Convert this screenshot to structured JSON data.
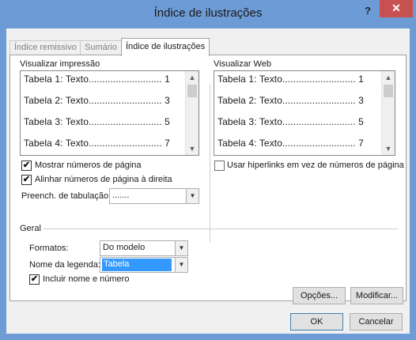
{
  "window": {
    "title": "Índice de ilustrações",
    "help_glyph": "?",
    "close_glyph": "✕"
  },
  "tabs": [
    {
      "label": "Índice remissivo",
      "active": false
    },
    {
      "label": "Sumário",
      "active": false
    },
    {
      "label": "Índice de ilustrações",
      "active": true
    }
  ],
  "print_preview": {
    "label": "Visualizar impressão",
    "rows": [
      "Tabela 1: Texto........................... 1",
      "Tabela 2: Texto........................... 3",
      "Tabela 3: Texto........................... 5",
      "Tabela 4: Texto........................... 7"
    ]
  },
  "web_preview": {
    "label": "Visualizar Web",
    "rows": [
      "Tabela 1: Texto........................... 1",
      "Tabela 2: Texto........................... 3",
      "Tabela 3: Texto........................... 5",
      "Tabela 4: Texto........................... 7"
    ]
  },
  "options": {
    "show_page_numbers": {
      "label": "Mostrar números de página",
      "checked": true
    },
    "right_align": {
      "label": "Alinhar números de página à direita",
      "checked": true
    },
    "tab_leader": {
      "label": "Preench. de tabulação:",
      "value": "......."
    },
    "use_hyperlinks": {
      "label": "Usar hiperlinks em vez de números de página",
      "checked": false
    }
  },
  "general": {
    "heading": "Geral",
    "formats": {
      "label": "Formatos:",
      "value": "Do modelo"
    },
    "caption_label": {
      "label": "Nome da legenda:",
      "value": "Tabela"
    },
    "include_label": {
      "label": "Incluir nome e número",
      "checked": true
    }
  },
  "buttons": {
    "options": "Opções...",
    "modify": "Modificar...",
    "ok": "OK",
    "cancel": "Cancelar"
  },
  "icons": {
    "check": "✔",
    "up": "▲",
    "down": "▼",
    "combo": "▼"
  },
  "colors": {
    "frame": "#6d9bd6",
    "close": "#c75050",
    "selection": "#3399ff"
  }
}
